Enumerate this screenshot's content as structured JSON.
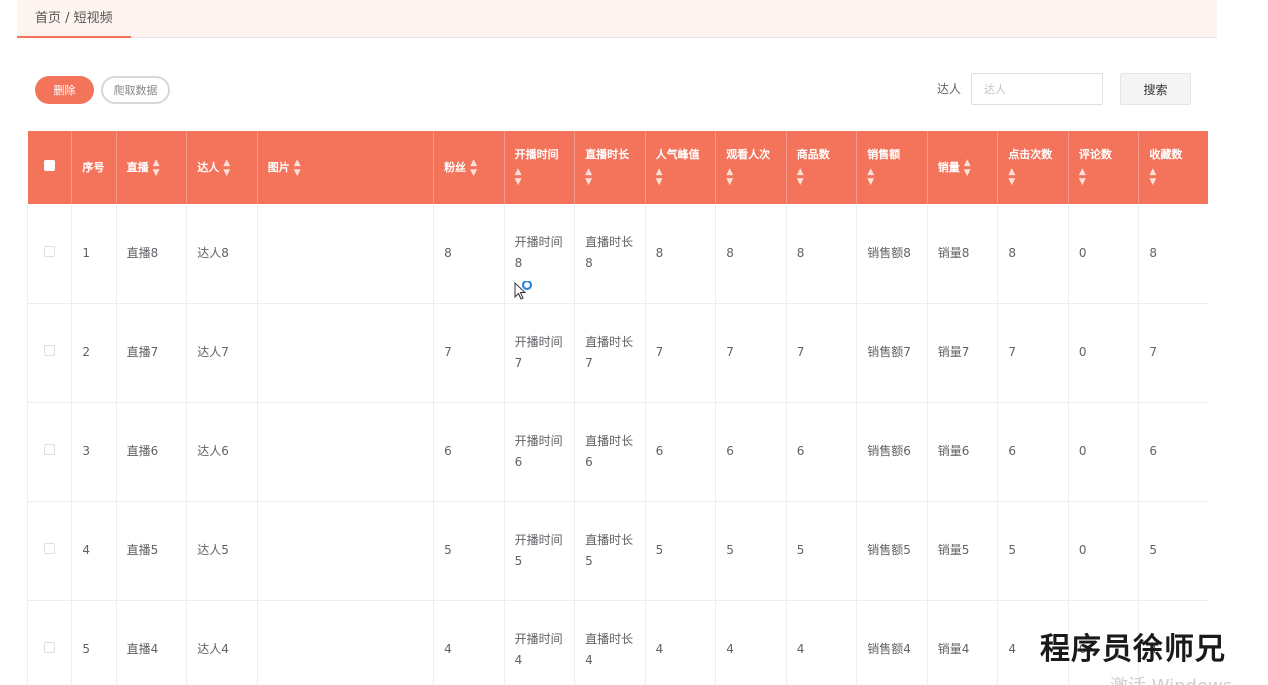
{
  "breadcrumb": "首页 / 短视频",
  "toolbar": {
    "delete_label": "删除",
    "crawl_label": "爬取数据",
    "search_label": "达人",
    "search_placeholder": "达人",
    "search_button": "搜索"
  },
  "table": {
    "headers": [
      {
        "label": "序号",
        "sortable": false
      },
      {
        "label": "直播",
        "sortable": true
      },
      {
        "label": "达人",
        "sortable": true
      },
      {
        "label": "图片",
        "sortable": true
      },
      {
        "label": "粉丝",
        "sortable": true
      },
      {
        "label": "开播时间",
        "sortable": true
      },
      {
        "label": "直播时长",
        "sortable": true
      },
      {
        "label": "人气峰值",
        "sortable": true
      },
      {
        "label": "观看人次",
        "sortable": true
      },
      {
        "label": "商品数",
        "sortable": true
      },
      {
        "label": "销售额",
        "sortable": true
      },
      {
        "label": "销量",
        "sortable": true
      },
      {
        "label": "点击次数",
        "sortable": true
      },
      {
        "label": "评论数",
        "sortable": true
      },
      {
        "label": "收藏数",
        "sortable": true
      }
    ],
    "rows": [
      {
        "index": "1",
        "live": "直播8",
        "talent": "达人8",
        "fans": "8",
        "start_label": "开播时间",
        "start_value": "8",
        "dur_label": "直播时长",
        "dur_value": "8",
        "peak": "8",
        "views": "8",
        "goods": "8",
        "sales_amount": "销售额8",
        "sales_volume": "销量8",
        "clicks": "8",
        "comments": "0",
        "favorites": "8"
      },
      {
        "index": "2",
        "live": "直播7",
        "talent": "达人7",
        "fans": "7",
        "start_label": "开播时间",
        "start_value": "7",
        "dur_label": "直播时长",
        "dur_value": "7",
        "peak": "7",
        "views": "7",
        "goods": "7",
        "sales_amount": "销售额7",
        "sales_volume": "销量7",
        "clicks": "7",
        "comments": "0",
        "favorites": "7"
      },
      {
        "index": "3",
        "live": "直播6",
        "talent": "达人6",
        "fans": "6",
        "start_label": "开播时间",
        "start_value": "6",
        "dur_label": "直播时长",
        "dur_value": "6",
        "peak": "6",
        "views": "6",
        "goods": "6",
        "sales_amount": "销售额6",
        "sales_volume": "销量6",
        "clicks": "6",
        "comments": "0",
        "favorites": "6"
      },
      {
        "index": "4",
        "live": "直播5",
        "talent": "达人5",
        "fans": "5",
        "start_label": "开播时间",
        "start_value": "5",
        "dur_label": "直播时长",
        "dur_value": "5",
        "peak": "5",
        "views": "5",
        "goods": "5",
        "sales_amount": "销售额5",
        "sales_volume": "销量5",
        "clicks": "5",
        "comments": "0",
        "favorites": "5"
      },
      {
        "index": "5",
        "live": "直播4",
        "talent": "达人4",
        "fans": "4",
        "start_label": "开播时间",
        "start_value": "4",
        "dur_label": "直播时长",
        "dur_value": "4",
        "peak": "4",
        "views": "4",
        "goods": "4",
        "sales_amount": "销售额4",
        "sales_volume": "销量4",
        "clicks": "4",
        "comments": "0",
        "favorites": "4"
      }
    ]
  },
  "overlay": {
    "watermark": "程序员徐师兄",
    "activate_windows": "激活 Windows"
  },
  "colors": {
    "accent": "#f3735b",
    "header_bg": "#fdf3ef"
  }
}
